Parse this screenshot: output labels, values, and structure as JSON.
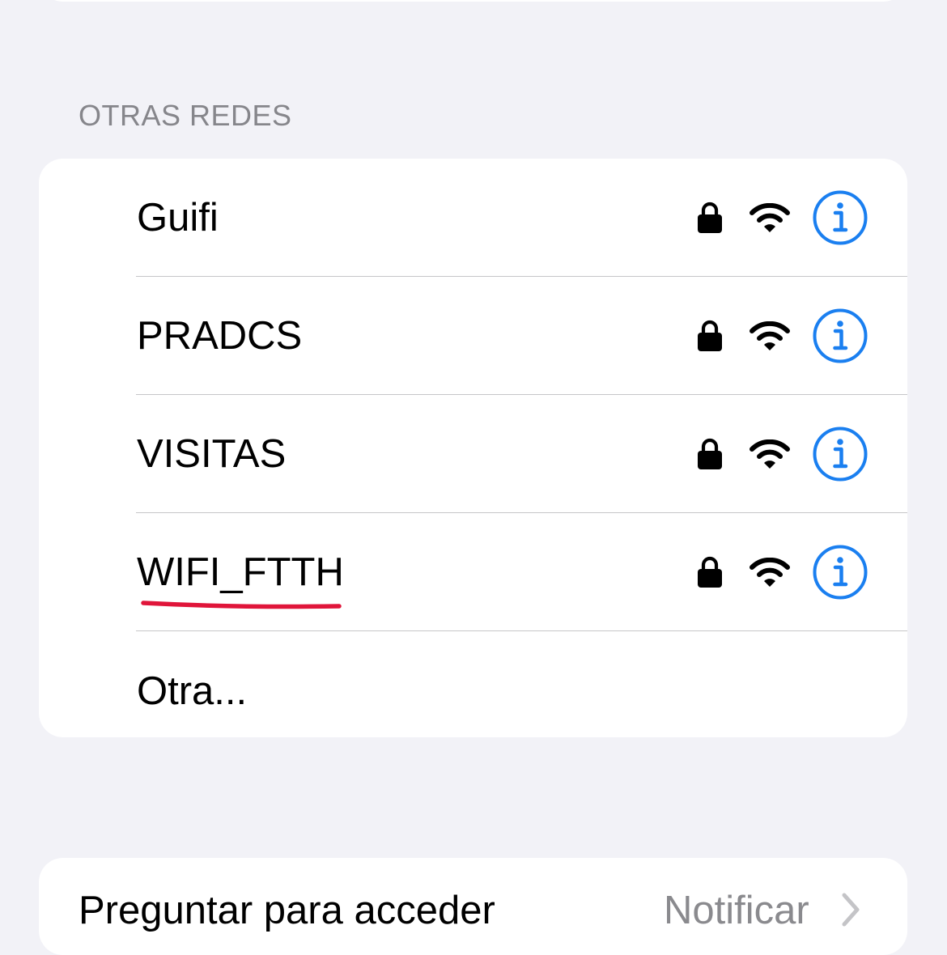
{
  "section": {
    "header": "OTRAS REDES"
  },
  "networks": [
    {
      "name": "Guifi",
      "secured": true,
      "lock_icon": "lock-icon",
      "signal_icon": "wifi-icon",
      "info_icon": "info-icon"
    },
    {
      "name": "PRADCS",
      "secured": true,
      "lock_icon": "lock-icon",
      "signal_icon": "wifi-icon",
      "info_icon": "info-icon"
    },
    {
      "name": "VISITAS",
      "secured": true,
      "lock_icon": "lock-icon",
      "signal_icon": "wifi-icon",
      "info_icon": "info-icon"
    },
    {
      "name": "WIFI_FTTH",
      "secured": true,
      "lock_icon": "lock-icon",
      "signal_icon": "wifi-icon",
      "info_icon": "info-icon",
      "annotation": "red-underline"
    }
  ],
  "other": {
    "label": "Otra..."
  },
  "bottom_row": {
    "label": "Preguntar para acceder",
    "value": "Notificar",
    "chevron_icon": "chevron-right-icon"
  },
  "colors": {
    "background": "#f2f2f7",
    "card": "#ffffff",
    "accent_blue": "#1a7ff0",
    "header_gray": "#86868b",
    "separator": "#c6c6c8",
    "annotation_red": "#e0153a"
  }
}
